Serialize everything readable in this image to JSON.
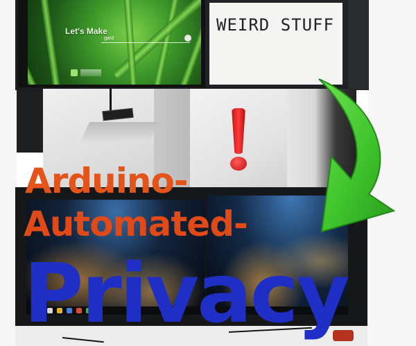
{
  "collage": {
    "title_lines": [
      "Arduino-",
      "Automated-",
      "Privacy"
    ],
    "title_colors": {
      "line1": "#e3541b",
      "line2": "#e04a18",
      "line3": "#1f2fc6"
    },
    "arrow_color": "#3fc42c"
  },
  "left_monitor": {
    "heading": "Let's Make",
    "search_text": "gard",
    "search_icon": "search-icon"
  },
  "right_monitor": {
    "sign_text": "WEIRD STUFF"
  },
  "exclamation": {
    "symbol": "!",
    "color": "#e01818"
  }
}
